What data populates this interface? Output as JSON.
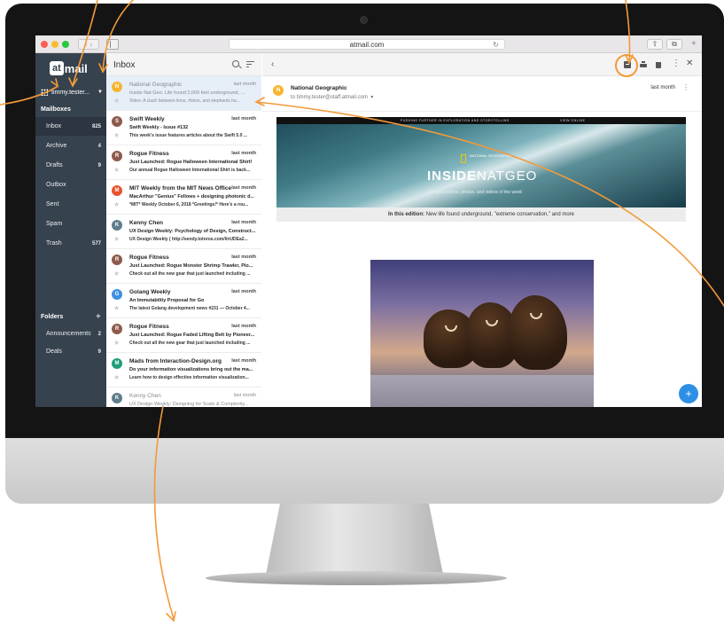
{
  "browser": {
    "url": "atmail.com"
  },
  "app": {
    "logo_at": "at",
    "logo_word": "mail",
    "account": "timmy.tester...",
    "mailboxes_heading": "Mailboxes",
    "mailboxes": [
      {
        "label": "Inbox",
        "count": "825"
      },
      {
        "label": "Archive",
        "count": "4"
      },
      {
        "label": "Drafts",
        "count": "9"
      },
      {
        "label": "Outbox",
        "count": ""
      },
      {
        "label": "Sent",
        "count": ""
      },
      {
        "label": "Spam",
        "count": ""
      },
      {
        "label": "Trash",
        "count": "577"
      }
    ],
    "folders_heading": "Folders",
    "folders": [
      {
        "label": "Announcements",
        "count": "2"
      },
      {
        "label": "Deals",
        "count": "9"
      }
    ]
  },
  "inbox": {
    "title": "Inbox",
    "messages": [
      {
        "initial": "N",
        "color": "#f6b531",
        "sender": "National Geographic",
        "date": "last month",
        "subject": "Inside Nat Geo: Life found 2,000 feet underground, ...",
        "preview": "Video: A clash between lions, rhinos, and elephants ha..."
      },
      {
        "initial": "S",
        "color": "#8d5a4b",
        "sender": "Swift Weekly",
        "date": "last month",
        "subject": "Swift Weekly - Issue #132",
        "preview": "This week's issue features articles about the Swift 5.0 ..."
      },
      {
        "initial": "R",
        "color": "#8d5a4b",
        "sender": "Rogue Fitness",
        "date": "last month",
        "subject": "Just Launched: Rogue Halloween International Shirt!",
        "preview": "Our annual Rogue Halloween International Shirt is back..."
      },
      {
        "initial": "M",
        "color": "#e8532f",
        "sender": "MIT Weekly from the MIT News Office",
        "date": "last month",
        "subject": "MacArthur \"Genius\" Fellows + designing photonic d...",
        "preview": "*MIT* Weekly October 6, 2018 *Greetings!* Here's a rou..."
      },
      {
        "initial": "K",
        "color": "#607d8b",
        "sender": "Kenny Chen",
        "date": "last month",
        "subject": "UX Design Weekly: Psychology of Design, Construct...",
        "preview": "UX Design Weekly ( http://sendy.totoros.com/l/nUDEa2..."
      },
      {
        "initial": "R",
        "color": "#8d5a4b",
        "sender": "Rogue Fitness",
        "date": "last month",
        "subject": "Just Launched: Rogue Monster Shrimp Trawler, Pio...",
        "preview": "Check out all the new gear that just launched including ..."
      },
      {
        "initial": "G",
        "color": "#3d8fe0",
        "sender": "Golang Weekly",
        "date": "last month",
        "subject": "An Immutability Proposal for Go",
        "preview": "The latest Golang development news #231 — October 4..."
      },
      {
        "initial": "R",
        "color": "#8d5a4b",
        "sender": "Rogue Fitness",
        "date": "last month",
        "subject": "Just Launched: Rogue Faded Lifting Belt by Pioneer...",
        "preview": "Check out all the new gear that just launched including ..."
      },
      {
        "initial": "M",
        "color": "#1e9e7a",
        "sender": "Mads from Interaction-Design.org",
        "date": "last month",
        "subject": "Do your information visualizations bring out the ma...",
        "preview": "Learn how to design effective information visualization..."
      },
      {
        "initial": "K",
        "color": "#607d8b",
        "sender": "Kenny Chen",
        "date": "last month",
        "subject": "UX Design Weekly: Designing for Scale & Complexity...",
        "preview": ""
      }
    ]
  },
  "reader": {
    "sender": "National Geographic",
    "initial": "N",
    "to": "to timmy.tester@staff.atmail.com",
    "date": "last month",
    "banner_tagline": "PUSHING FURTHER IN EXPLORATION AND STORYTELLING",
    "banner_view": "VIEW ONLINE",
    "ng_logo_text": "NATIONAL GEOGRAPHIC",
    "inside_bold": "INSIDE",
    "inside_light": "NATGEO",
    "banner_sub": "Our best stories, photos, and videos of the week",
    "edition_label": "In this edition:",
    "edition_text": " New life found underground, \"extreme conservation,\" and more"
  },
  "colors": {
    "sidebar": "#37424f",
    "accent_orange": "#f39a3a",
    "fab_blue": "#2e8fe6"
  }
}
